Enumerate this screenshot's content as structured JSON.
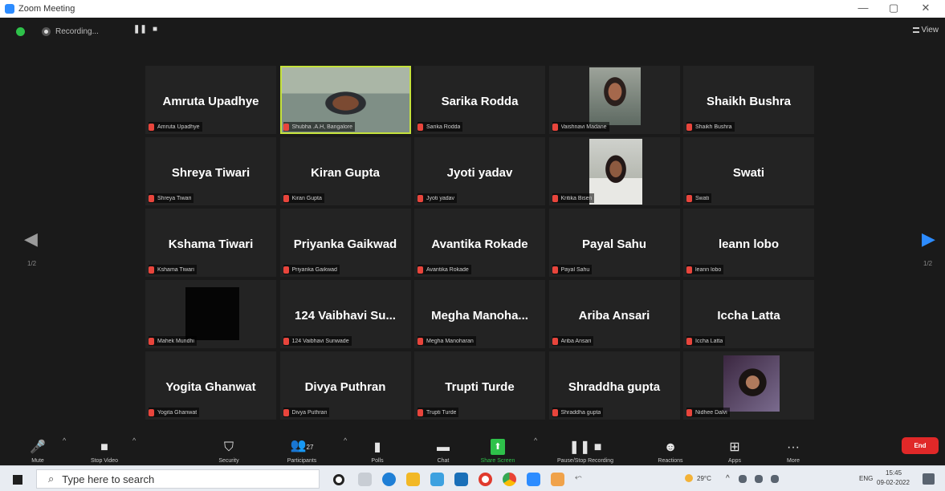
{
  "window": {
    "title": "Zoom Meeting",
    "minimize": "—",
    "maximize": "▢",
    "close": "✕"
  },
  "top_bar": {
    "recording_label": "Recording...",
    "pause_glyph": "❚❚",
    "stop_glyph": "■",
    "view_label": "View"
  },
  "navigation": {
    "prev_glyph": "◀",
    "next_glyph": "▶",
    "left_page": "1/2",
    "right_page": "1/2"
  },
  "participants": [
    {
      "display": "Amruta Upadhye",
      "label": "Amruta Upadhye",
      "video": ""
    },
    {
      "display": "",
      "label": "Shubha .A.H, Bangalore",
      "video": "shubha",
      "speaking": true
    },
    {
      "display": "Sarika Rodda",
      "label": "Sarika Rodda",
      "video": ""
    },
    {
      "display": "",
      "label": "Vaishnavi Madane",
      "video": "vaishnavi"
    },
    {
      "display": "Shaikh Bushra",
      "label": "Shaikh Bushra",
      "video": ""
    },
    {
      "display": "Shreya Tiwari",
      "label": "Shreya Tiwari",
      "video": ""
    },
    {
      "display": "Kiran Gupta",
      "label": "Kiran Gupta",
      "video": ""
    },
    {
      "display": "Jyoti yadav",
      "label": "Jyoti yadav",
      "video": ""
    },
    {
      "display": "",
      "label": "Kritika Bisen",
      "video": "kritika"
    },
    {
      "display": "Swati",
      "label": "Swati",
      "video": ""
    },
    {
      "display": "Kshama Tiwari",
      "label": "Kshama Tiwari",
      "video": ""
    },
    {
      "display": "Priyanka Gaikwad",
      "label": "Priyanka Gaikwad",
      "video": ""
    },
    {
      "display": "Avantika Rokade",
      "label": "Avantika Rokade",
      "video": ""
    },
    {
      "display": "Payal Sahu",
      "label": "Payal Sahu",
      "video": ""
    },
    {
      "display": "leann lobo",
      "label": "leann lobo",
      "video": ""
    },
    {
      "display": "",
      "label": "Mahek Mundhi",
      "video": "mahek"
    },
    {
      "display": "124 Vaibhavi Su...",
      "label": "124 Vaibhavi Sunwade",
      "video": ""
    },
    {
      "display": "Megha Manoha...",
      "label": "Megha Manoharan",
      "video": ""
    },
    {
      "display": "Ariba Ansari",
      "label": "Ariba Ansari",
      "video": ""
    },
    {
      "display": "Iccha Latta",
      "label": "Iccha Latta",
      "video": ""
    },
    {
      "display": "Yogita Ghanwat",
      "label": "Yogita Ghanwat",
      "video": ""
    },
    {
      "display": "Divya Puthran",
      "label": "Divya Puthran",
      "video": ""
    },
    {
      "display": "Trupti Turde",
      "label": "Trupti Turde",
      "video": ""
    },
    {
      "display": "Shraddha gupta",
      "label": "Shraddha gupta",
      "video": ""
    },
    {
      "display": "",
      "label": "Nidhee Dalvi",
      "video": "nidhee"
    }
  ],
  "toolbar": {
    "mute": {
      "label": "Mute",
      "icon": "🎤"
    },
    "stop_video": {
      "label": "Stop Video",
      "icon": "■"
    },
    "security": {
      "label": "Security",
      "icon": "⛉"
    },
    "participants": {
      "label": "Participants",
      "icon": "👥",
      "count": "27"
    },
    "polls": {
      "label": "Polls",
      "icon": "▮"
    },
    "chat": {
      "label": "Chat",
      "icon": "▬"
    },
    "share_screen": {
      "label": "Share Screen",
      "icon": "⬆"
    },
    "recording": {
      "label": "Pause/Stop Recording",
      "icon": "❚❚ ■"
    },
    "reactions": {
      "label": "Reactions",
      "icon": "☻"
    },
    "apps": {
      "label": "Apps",
      "icon": "⊞"
    },
    "more": {
      "label": "More",
      "icon": "···"
    },
    "caret": "^",
    "end": "End"
  },
  "taskbar": {
    "search_placeholder": "Type here to search",
    "weather": "29°C",
    "language": "ENG",
    "time": "15:45",
    "date": "09-02-2022"
  },
  "colors": {
    "accent": "#2d8cff",
    "speaking_border": "#c5e23c",
    "end_button": "#e02828",
    "share_green": "#2ec14a",
    "muted_red": "#e8453c"
  }
}
